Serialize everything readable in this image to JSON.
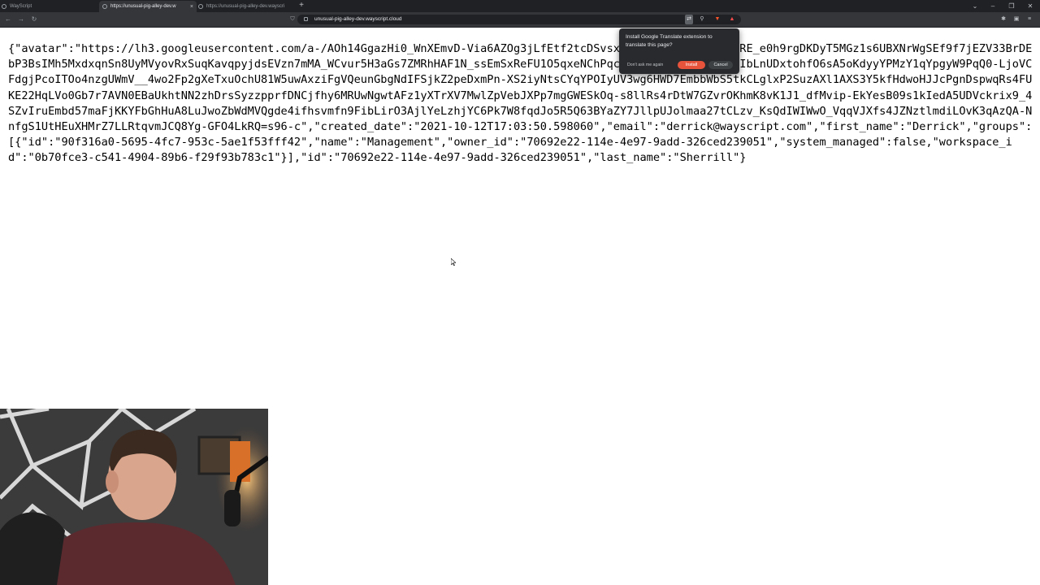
{
  "browser": {
    "tabs": [
      {
        "title": "WayScript",
        "active": false
      },
      {
        "title": "https://unusual-pig-alley-dev.w",
        "active": true
      },
      {
        "title": "https://unusual-pig-alley-dev.wayscri",
        "active": false
      }
    ],
    "tab_close_glyph": "×",
    "new_tab_glyph": "+",
    "address": "unusual-pig-alley-dev.wayscript.cloud"
  },
  "page": {
    "json_text": "{\"avatar\":\"https://lh3.googleusercontent.com/a-/AOh14GgazHi0_WnXEmvD-Via6AZOg3jLfEtf2tcDSvsx8sXb3FmqRGxz2aLEvCRE_e0h9rgDKDyT5MGz1s6UBXNrWgSEf9f7jEZV33BrDEbP3BsIMh5MxdxqnSn8UyMVyovRxSuqKavqpyjdsEVzn7mMA_WCvur5H3aGs7ZMRhHAF1N_ssEmSxReFU1O5qxeNChPqctYzj2sUt1RgH0pxioxIbLnUDxtohfO6sA5oKdyyYPMzY1qYpgyW9PqQ0-LjoVCFdgjPcoITOo4nzgUWmV__4wo2Fp2gXeTxuOchU81W5uwAxziFgVQeunGbgNdIFSjkZ2peDxmPn-XS2iyNtsCYqYPOIyUV3wg6HWD7EmbbWbS5tkCLglxP2SuzAXl1AXS3Y5kfHdwoHJJcPgnDspwqRs4FUKE22HqLVo0Gb7r7AVN0EBaUkhtNN2zhDrsSyzzpprfDNCjfhy6MRUwNgwtAFz1yXTrXV7MwlZpVebJXPp7mgGWESkOq-s8llRs4rDtW7GZvrOKhmK8vK1J1_dfMvip-EkYesB09s1kIedA5UDVckrix9_4SZvIruEmbd57maFjKKYFbGhHuA8LuJwoZbWdMVQgde4ifhsvmfn9FibLirO3AjlYeLzhjYC6Pk7W8fqdJo5R5Q63BYaZY7JllpUJolmaa27tCLzv_KsQdIWIWwO_VqqVJXfs4JZNztlmdiLOvK3qAzQA-NnfgS1UtHEuXHMrZ7LLRtqvmJCQ8Yg-GFO4LkRQ=s96-c\",\"created_date\":\"2021-10-12T17:03:50.598060\",\"email\":\"derrick@wayscript.com\",\"first_name\":\"Derrick\",\"groups\":[{\"id\":\"90f316a0-5695-4fc7-953c-5ae1f53fff42\",\"name\":\"Management\",\"owner_id\":\"70692e22-114e-4e97-9add-326ced239051\",\"system_managed\":false,\"workspace_id\":\"0b70fce3-c541-4904-89b6-f29f93b783c1\"}],\"id\":\"70692e22-114e-4e97-9add-326ced239051\",\"last_name\":\"Sherrill\"}"
  },
  "translate_popup": {
    "message": "Install Google Translate extension to translate this page?",
    "dont_ask": "Don't ask me again",
    "install": "Install",
    "cancel": "Cancel"
  },
  "colors": {
    "tab_strip": "#202124",
    "toolbar": "#35363a",
    "install_button": "#e8533c"
  },
  "icons": [
    "back-icon",
    "forward-icon",
    "reload-icon",
    "bookmark-icon",
    "lock-icon",
    "translate-icon",
    "zoom-icon",
    "brave-shield-icon",
    "rewards-icon",
    "extensions-icon",
    "menu-icon"
  ]
}
